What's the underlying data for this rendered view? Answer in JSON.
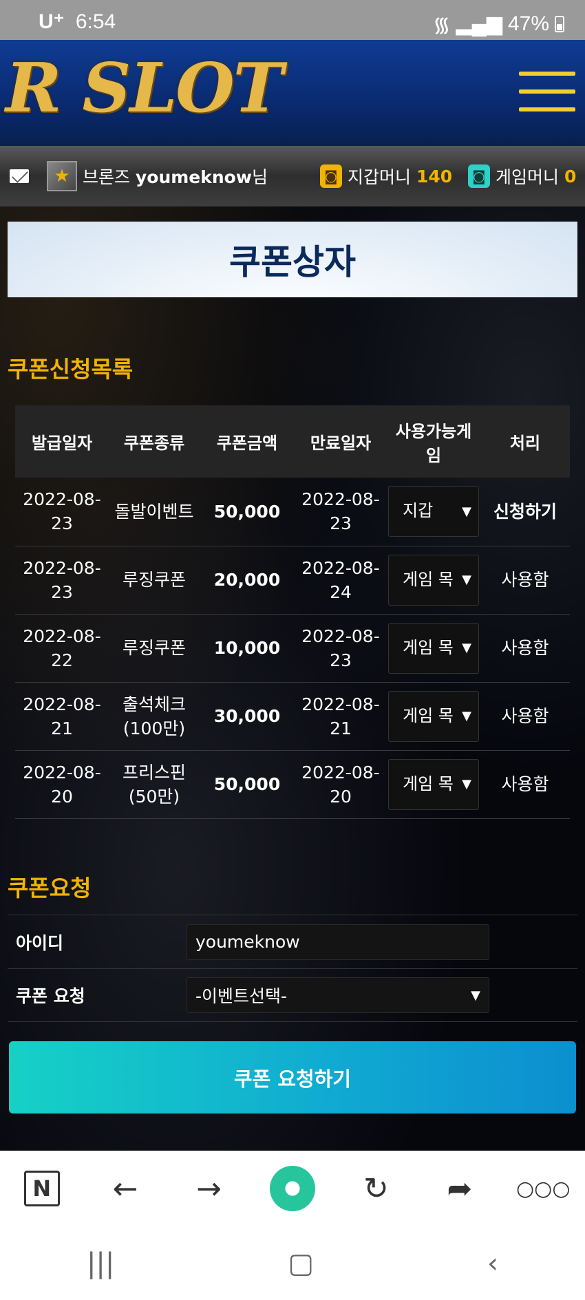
{
  "status_bar": {
    "carrier": "U⁺",
    "time": "6:54",
    "battery": "47%"
  },
  "header": {
    "logo_text": "R SLOT"
  },
  "user_bar": {
    "rank": "브론즈",
    "username": "youmeknow",
    "suffix": "님",
    "wallet_label": "지갑머니",
    "wallet_amount": "140",
    "game_label": "게임머니",
    "game_amount": "0"
  },
  "page_title": "쿠폰상자",
  "list_section_title": "쿠폰신청목록",
  "table": {
    "headers": [
      "발급일자",
      "쿠폰종류",
      "쿠폰금액",
      "만료일자",
      "사용가능게임",
      "처리"
    ],
    "rows": [
      {
        "issued": "2022-08-23",
        "type": "돌발이벤트",
        "amount": "50,000",
        "expires": "2022-08-23",
        "game": "지갑",
        "action": "신청하기"
      },
      {
        "issued": "2022-08-23",
        "type": "루징쿠폰",
        "amount": "20,000",
        "expires": "2022-08-24",
        "game": "게임 목",
        "action": "사용함"
      },
      {
        "issued": "2022-08-22",
        "type": "루징쿠폰",
        "amount": "10,000",
        "expires": "2022-08-23",
        "game": "게임 목",
        "action": "사용함"
      },
      {
        "issued": "2022-08-21",
        "type": "출석체크\n(100만)",
        "amount": "30,000",
        "expires": "2022-08-21",
        "game": "게임 목",
        "action": "사용함"
      },
      {
        "issued": "2022-08-20",
        "type": "프리스핀\n(50만)",
        "amount": "50,000",
        "expires": "2022-08-20",
        "game": "게임 목",
        "action": "사용함"
      }
    ]
  },
  "request_section_title": "쿠폰요청",
  "form": {
    "id_label": "아이디",
    "id_value": "youmeknow",
    "coupon_label": "쿠폰 요청",
    "coupon_select": "-이벤트선택-",
    "submit_label": "쿠폰 요청하기"
  },
  "colors": {
    "accent": "#f2b400",
    "button_start": "#16d1c6",
    "button_end": "#0c8fcf",
    "header": "#0f3c94"
  }
}
